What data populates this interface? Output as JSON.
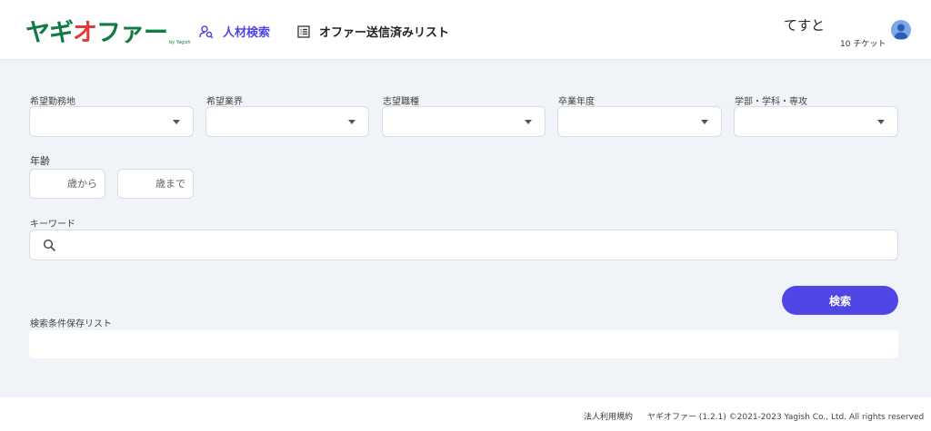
{
  "header": {
    "logo": "ヤギオファー",
    "logo_sub": "by Yagish",
    "nav": {
      "search_label": "人材検索",
      "offer_list_label": "オファー送信済みリスト"
    },
    "user": {
      "name": "てすと",
      "tickets": "10 チケット"
    }
  },
  "filters": {
    "location": {
      "label": "希望勤務地",
      "value": ""
    },
    "industry": {
      "label": "希望業界",
      "value": ""
    },
    "job_type": {
      "label": "志望職種",
      "value": ""
    },
    "grad_year": {
      "label": "卒業年度",
      "value": ""
    },
    "faculty": {
      "label": "学部・学科・専攻",
      "value": ""
    }
  },
  "age": {
    "label": "年齢",
    "from_suffix": "歳から",
    "to_suffix": "歳まで"
  },
  "keyword": {
    "label": "キーワード",
    "value": ""
  },
  "search_button": "検索",
  "saved_conditions": {
    "label": "検索条件保存リスト"
  },
  "footer": {
    "terms": "法人利用規約",
    "copyright": "ヤギオファー (1.2.1) ©2021-2023 Yagish Co., Ltd. All rights reserved"
  },
  "colors": {
    "brand_green": "#127a44",
    "brand_red": "#e23a3a",
    "accent": "#4f46e5",
    "background": "#f0f3f8"
  }
}
